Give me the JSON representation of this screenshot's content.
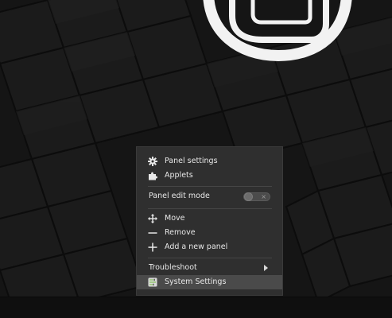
{
  "colors": {
    "menu_background": "#2f2f2f",
    "menu_highlight": "#4a4a4a",
    "menu_text": "#e8e8e8",
    "panel_background": "#0f0f0f",
    "wallpaper_dark": "#141414",
    "logo_white": "#f2f2f2"
  },
  "wallpaper": {
    "logo_icon": "linux-mint-logo"
  },
  "context_menu": {
    "items": [
      {
        "label": "Panel settings",
        "icon": "gear-icon"
      },
      {
        "label": "Applets",
        "icon": "puzzle-icon"
      },
      {
        "label": "Panel edit mode",
        "toggle_state": "off"
      },
      {
        "label": "Move",
        "icon": "move-arrows-icon"
      },
      {
        "label": "Remove",
        "icon": "minus-icon"
      },
      {
        "label": "Add a new panel",
        "icon": "plus-icon"
      },
      {
        "label": "Troubleshoot",
        "has_submenu": true
      },
      {
        "label": "System Settings",
        "icon": "system-settings-icon",
        "highlighted": true
      }
    ],
    "toggle_off_symbol": "×"
  }
}
